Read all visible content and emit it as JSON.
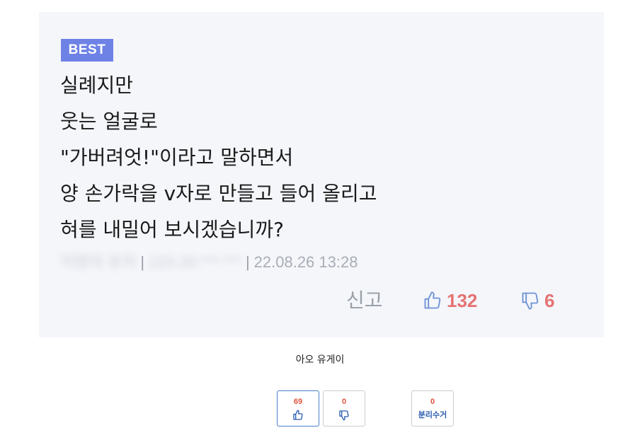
{
  "comment": {
    "badge": "BEST",
    "lines": [
      "실례지만",
      "웃는 얼굴로",
      "\"가버려엇!\"이라고 말하면서",
      "양 손가락을 v자로 만들고 들어 올리고",
      "혀를 내밀어 보시겠습니까?"
    ],
    "meta": {
      "author": "익명의 유저",
      "ip": "223.33.***.***",
      "separator": "|",
      "timestamp": "22.08.26 13:28"
    },
    "report_label": "신고",
    "upvotes": "132",
    "downvotes": "6",
    "colors": {
      "badge": "#6e82e6",
      "vote_count": "#e57373",
      "card_bg": "#f4f6fa"
    }
  },
  "post": {
    "text": "아오 유게이"
  },
  "recommend": {
    "up_count": "69",
    "down_count": "0",
    "separate_count": "0",
    "separate_label": "분리수거",
    "icons": {
      "up": "thumbs-up-icon",
      "down": "thumbs-down-icon"
    }
  }
}
